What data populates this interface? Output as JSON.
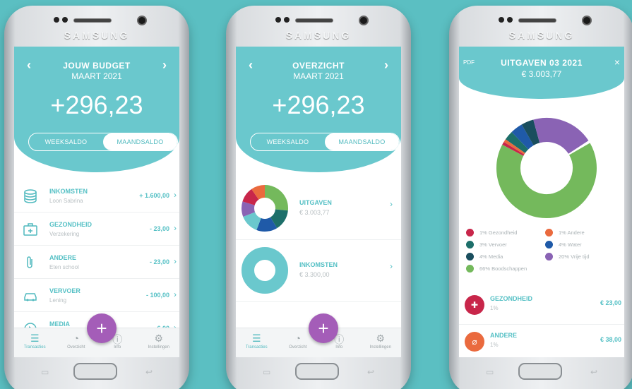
{
  "colors": {
    "teal": "#6ac8cd",
    "fab": "#a45db8",
    "background": "#5bbfc2"
  },
  "phones": [
    {
      "brand": "SAMSUNG",
      "header": {
        "title": "JOUW BUDGET",
        "subtitle": "MAART 2021",
        "amount": "+296,23",
        "segments": [
          "WEEKSALDO",
          "MAANDSALDO"
        ]
      },
      "rows": [
        {
          "name": "INKOMSTEN",
          "desc": "Loon Sabrina",
          "value": "+ 1.600,00",
          "icon": "coins-icon"
        },
        {
          "name": "GEZONDHEID",
          "desc": "Verzekering",
          "value": "- 23,00",
          "icon": "medical-kit-icon"
        },
        {
          "name": "ANDERE",
          "desc": "Eten school",
          "value": "- 23,00",
          "icon": "paperclip-icon"
        },
        {
          "name": "VERVOER",
          "desc": "Lening",
          "value": "- 100,00",
          "icon": "car-icon"
        },
        {
          "name": "MEDIA",
          "desc": "",
          "value": "- 6,00",
          "icon": "play-icon"
        }
      ]
    },
    {
      "brand": "SAMSUNG",
      "header": {
        "title": "OVERZICHT",
        "subtitle": "MAART 2021",
        "amount": "+296,23",
        "segments": [
          "WEEKSALDO",
          "MAANDSALDO"
        ]
      },
      "categories": [
        {
          "name": "UITGAVEN",
          "amount": "€ 3.003,77"
        },
        {
          "name": "INKOMSTEN",
          "amount": "€ 3.300,00"
        }
      ]
    },
    {
      "brand": "SAMSUNG",
      "header": {
        "pdf": "PDF",
        "title": "UITGAVEN 03 2021",
        "amount": "€ 3.003,77",
        "close": "×"
      },
      "legend": [
        {
          "label": "1% Gezondheid",
          "color": "#c8264a"
        },
        {
          "label": "1% Andere",
          "color": "#ea6a3e"
        },
        {
          "label": "3% Vervoer",
          "color": "#1d6f6a"
        },
        {
          "label": "4% Water",
          "color": "#1f5aa8"
        },
        {
          "label": "4% Media",
          "color": "#1a4e5e"
        },
        {
          "label": "20% Vrije tijd",
          "color": "#8a63b4"
        },
        {
          "label": "66% Boodschappen",
          "color": "#74b95c"
        }
      ],
      "rows": [
        {
          "name": "GEZONDHEID",
          "desc": "1%",
          "value": "€ 23,00",
          "color": "#c8264a",
          "icon": "medical-kit-icon"
        },
        {
          "name": "ANDERE",
          "desc": "1%",
          "value": "€ 38,00",
          "color": "#ea6a3e",
          "icon": "paperclip-icon"
        }
      ]
    }
  ],
  "nav": [
    "Transacties",
    "Overzicht",
    "Info",
    "Instellingen"
  ],
  "fab_label": "+"
}
